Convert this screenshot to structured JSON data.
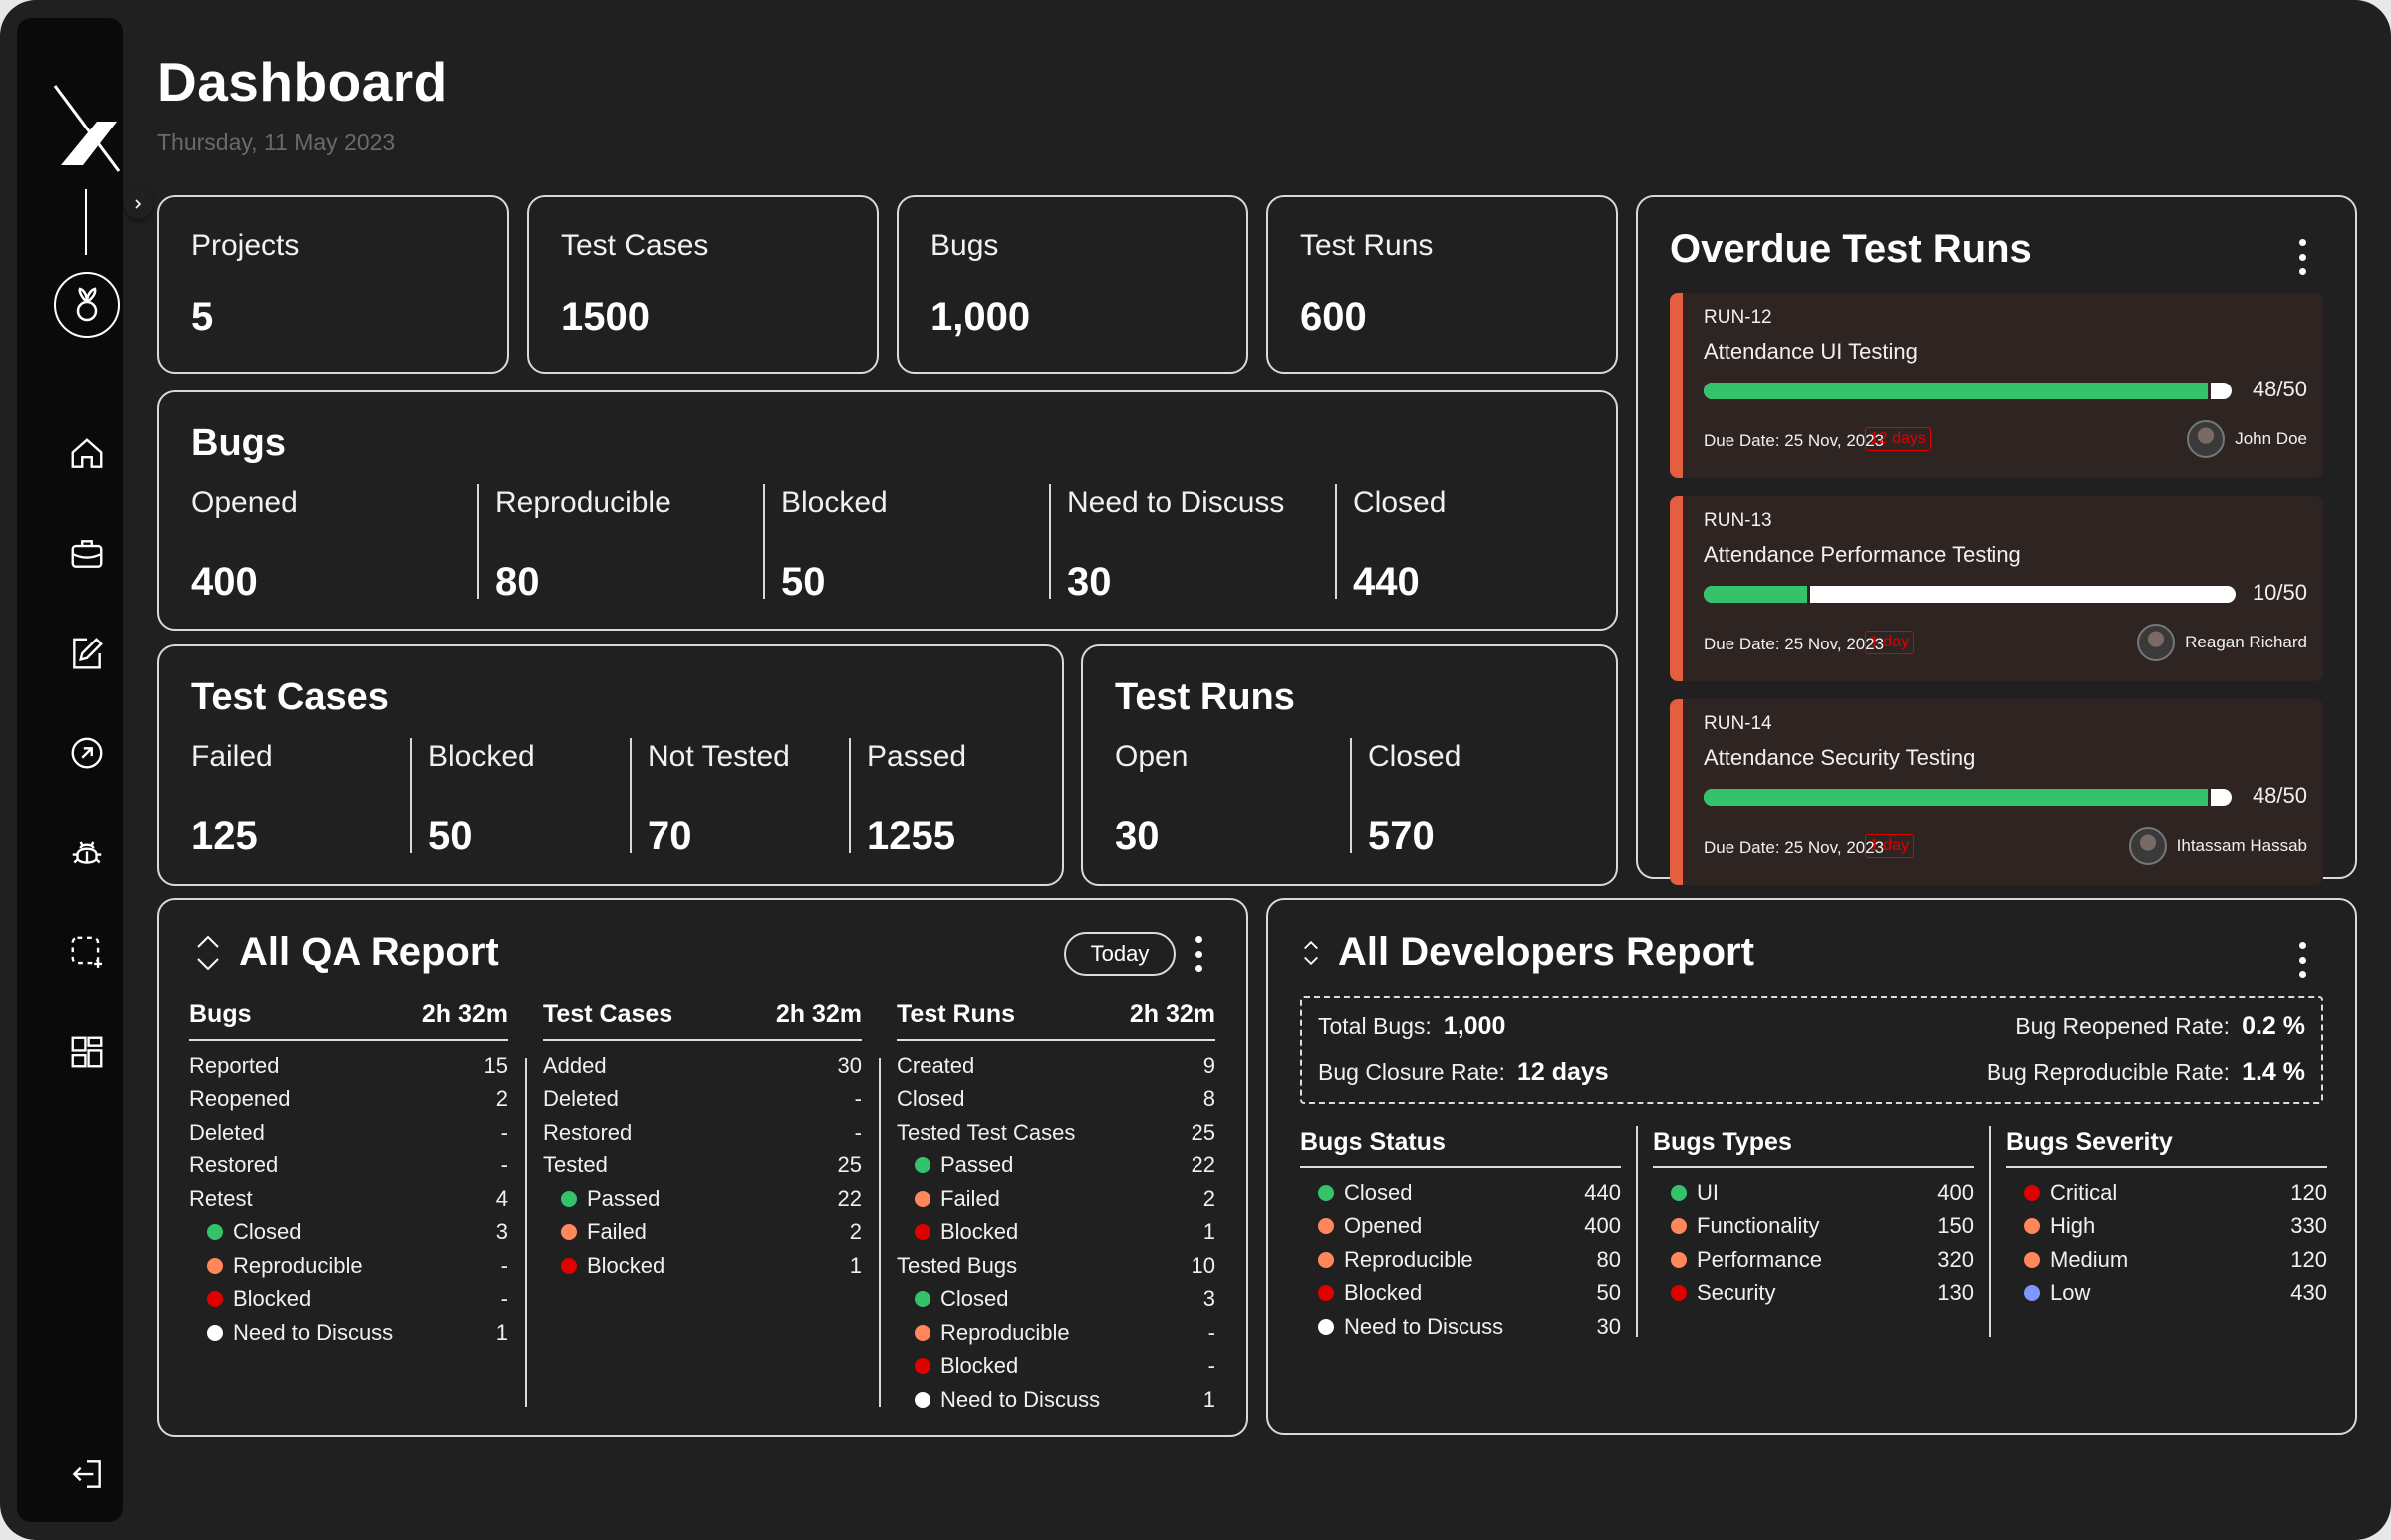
{
  "header": {
    "title": "Dashboard",
    "date": "Thursday, 11 May 2023"
  },
  "sidebar": {
    "items": [
      {
        "name": "home",
        "icon": "home-icon"
      },
      {
        "name": "projects",
        "icon": "briefcase-icon"
      },
      {
        "name": "test-cases",
        "icon": "edit-icon"
      },
      {
        "name": "test-runs",
        "icon": "arrow-circle-icon"
      },
      {
        "name": "bugs",
        "icon": "bug-icon"
      },
      {
        "name": "add-area",
        "icon": "dashed-square-plus-icon"
      },
      {
        "name": "dashboard",
        "icon": "grid-icon"
      }
    ],
    "logout_icon": "logout-icon"
  },
  "stats": [
    {
      "label": "Projects",
      "value": "5"
    },
    {
      "label": "Test Cases",
      "value": "1500"
    },
    {
      "label": "Bugs",
      "value": "1,000"
    },
    {
      "label": "Test Runs",
      "value": "600"
    }
  ],
  "bugs": {
    "title": "Bugs",
    "metrics": [
      {
        "label": "Opened",
        "value": "400"
      },
      {
        "label": "Reproducible",
        "value": "80"
      },
      {
        "label": "Blocked",
        "value": "50"
      },
      {
        "label": "Need to Discuss",
        "value": "30"
      },
      {
        "label": "Closed",
        "value": "440"
      }
    ]
  },
  "test_cases": {
    "title": "Test Cases",
    "metrics": [
      {
        "label": "Failed",
        "value": "125"
      },
      {
        "label": "Blocked",
        "value": "50"
      },
      {
        "label": "Not Tested",
        "value": "70"
      },
      {
        "label": "Passed",
        "value": "1255"
      }
    ]
  },
  "test_runs": {
    "title": "Test Runs",
    "metrics": [
      {
        "label": "Open",
        "value": "30"
      },
      {
        "label": "Closed",
        "value": "570"
      }
    ]
  },
  "overdue": {
    "title": "Overdue Test Runs",
    "runs": [
      {
        "id": "RUN-12",
        "name": "Attendance UI Testing",
        "done": 48,
        "total": 50,
        "progress_label": "48/50",
        "due": "Due Date: 25 Nov, 2023",
        "overdue": "12 days",
        "assignee": "John Doe"
      },
      {
        "id": "RUN-13",
        "name": "Attendance Performance Testing",
        "done": 10,
        "total": 50,
        "progress_label": "10/50",
        "due": "Due Date: 25 Nov, 2023",
        "overdue": "1 day",
        "assignee": "Reagan Richard"
      },
      {
        "id": "RUN-14",
        "name": "Attendance Security Testing",
        "done": 48,
        "total": 50,
        "progress_label": "48/50",
        "due": "Due Date: 25 Nov, 2023",
        "overdue": "1 day",
        "assignee": "Ihtassam Hassab"
      }
    ]
  },
  "qa_report": {
    "title": "All QA Report",
    "filter": "Today",
    "columns": [
      {
        "title": "Bugs",
        "duration": "2h 32m",
        "rows": [
          {
            "label": "Reported",
            "value": "15"
          },
          {
            "label": "Reopened",
            "value": "2"
          },
          {
            "label": "Deleted",
            "value": "-"
          },
          {
            "label": "Restored",
            "value": "-"
          },
          {
            "label": "Retest",
            "value": "4"
          },
          {
            "label": "Closed",
            "value": "3",
            "dot": "#34c26b"
          },
          {
            "label": "Reproducible",
            "value": "-",
            "dot": "#ff875a"
          },
          {
            "label": "Blocked",
            "value": "-",
            "dot": "#e00000"
          },
          {
            "label": "Need to Discuss",
            "value": "1",
            "dot": "#ffffff"
          }
        ]
      },
      {
        "title": "Test Cases",
        "duration": "2h 32m",
        "rows": [
          {
            "label": "Added",
            "value": "30"
          },
          {
            "label": "Deleted",
            "value": "-"
          },
          {
            "label": "Restored",
            "value": "-"
          },
          {
            "label": "Tested",
            "value": "25"
          },
          {
            "label": "Passed",
            "value": "22",
            "dot": "#34c26b"
          },
          {
            "label": "Failed",
            "value": "2",
            "dot": "#ff875a"
          },
          {
            "label": "Blocked",
            "value": "1",
            "dot": "#e00000"
          }
        ]
      },
      {
        "title": "Test Runs",
        "duration": "2h 32m",
        "rows": [
          {
            "label": "Created",
            "value": "9"
          },
          {
            "label": "Closed",
            "value": "8"
          },
          {
            "label": "Tested Test Cases",
            "value": "25"
          },
          {
            "label": "Passed",
            "value": "22",
            "dot": "#34c26b"
          },
          {
            "label": "Failed",
            "value": "2",
            "dot": "#ff875a"
          },
          {
            "label": "Blocked",
            "value": "1",
            "dot": "#e00000"
          },
          {
            "label": "Tested Bugs",
            "value": "10"
          },
          {
            "label": "Closed",
            "value": "3",
            "dot": "#34c26b"
          },
          {
            "label": "Reproducible",
            "value": "-",
            "dot": "#ff875a"
          },
          {
            "label": "Blocked",
            "value": "-",
            "dot": "#e00000"
          },
          {
            "label": "Need to Discuss",
            "value": "1",
            "dot": "#ffffff"
          }
        ]
      }
    ]
  },
  "dev_report": {
    "title": "All Developers Report",
    "summary": {
      "total_bugs_label": "Total Bugs:",
      "total_bugs": "1,000",
      "closure_label": "Bug Closure Rate:",
      "closure": "12 days",
      "reopened_label": "Bug Reopened Rate:",
      "reopened": "0.2 %",
      "reproducible_label": "Bug Reproducible Rate:",
      "reproducible": "1.4 %"
    },
    "columns": [
      {
        "title": "Bugs Status",
        "rows": [
          {
            "label": "Closed",
            "value": "440",
            "dot": "#34c26b"
          },
          {
            "label": "Opened",
            "value": "400",
            "dot": "#ff875a"
          },
          {
            "label": "Reproducible",
            "value": "80",
            "dot": "#ff875a"
          },
          {
            "label": "Blocked",
            "value": "50",
            "dot": "#e00000"
          },
          {
            "label": "Need to Discuss",
            "value": "30",
            "dot": "#ffffff"
          }
        ]
      },
      {
        "title": "Bugs Types",
        "rows": [
          {
            "label": "UI",
            "value": "400",
            "dot": "#34c26b"
          },
          {
            "label": "Functionality",
            "value": "150",
            "dot": "#ff875a"
          },
          {
            "label": "Performance",
            "value": "320",
            "dot": "#ff875a"
          },
          {
            "label": "Security",
            "value": "130",
            "dot": "#e00000"
          }
        ]
      },
      {
        "title": "Bugs Severity",
        "rows": [
          {
            "label": "Critical",
            "value": "120",
            "dot": "#e00000"
          },
          {
            "label": "High",
            "value": "330",
            "dot": "#ff875a"
          },
          {
            "label": "Medium",
            "value": "120",
            "dot": "#ff875a"
          },
          {
            "label": "Low",
            "value": "430",
            "dot": "#8096ff"
          }
        ]
      }
    ]
  },
  "colors": {
    "background": "#202020",
    "sidebar": "#0a0a0a",
    "accent_overdue": "#e35f3f",
    "progress_green": "#34c26b",
    "overdue_red": "#e00000"
  }
}
